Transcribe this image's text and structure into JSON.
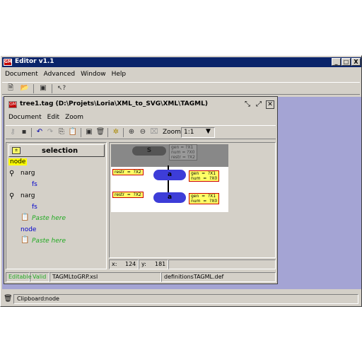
{
  "app": {
    "title": "Editor v1.1",
    "window_buttons": [
      "_",
      "□",
      "X"
    ],
    "menu": [
      "Document",
      "Advanced",
      "Window",
      "Help"
    ],
    "clipboard_label": "Clipboard:",
    "clipboard_value": "node"
  },
  "inner": {
    "title": "tree1.tag  (D:\\Projets\\Loria\\XML_to_SVG\\XML\\TAGML)",
    "menu": [
      "Document",
      "Edit",
      "Zoom"
    ],
    "zoom_label": "Zoom",
    "zoom_value": "1:1",
    "selection_label": "selection",
    "tree": {
      "root": "node",
      "item1": "narg",
      "item1_child": "fs",
      "item2": "narg",
      "item2_child": "fs",
      "paste1": "Paste here",
      "node2": "node",
      "paste2": "Paste here"
    },
    "canvas": {
      "root_label": "S",
      "root_feats": "gen = ?X1\nnum = ?X0\nrestr = ?X2",
      "node1_label": "a",
      "node1_left": "restr  =  ?X2",
      "node1_right": "gen  =  ?X1\nnum  =  ?X0",
      "node2_label": "a",
      "node2_left": "restr  =  ?X2",
      "node2_right": "gen  =  ?X1\nnum  =  ?X0"
    },
    "coords": {
      "x_label": "x:",
      "x_value": "124",
      "y_label": "y:",
      "y_value": "181"
    },
    "status": {
      "editable": "Editable",
      "valid": "Valid",
      "xsl": "TAGMLtoGRP.xsl",
      "def": "definitionsTAGML.def"
    }
  }
}
